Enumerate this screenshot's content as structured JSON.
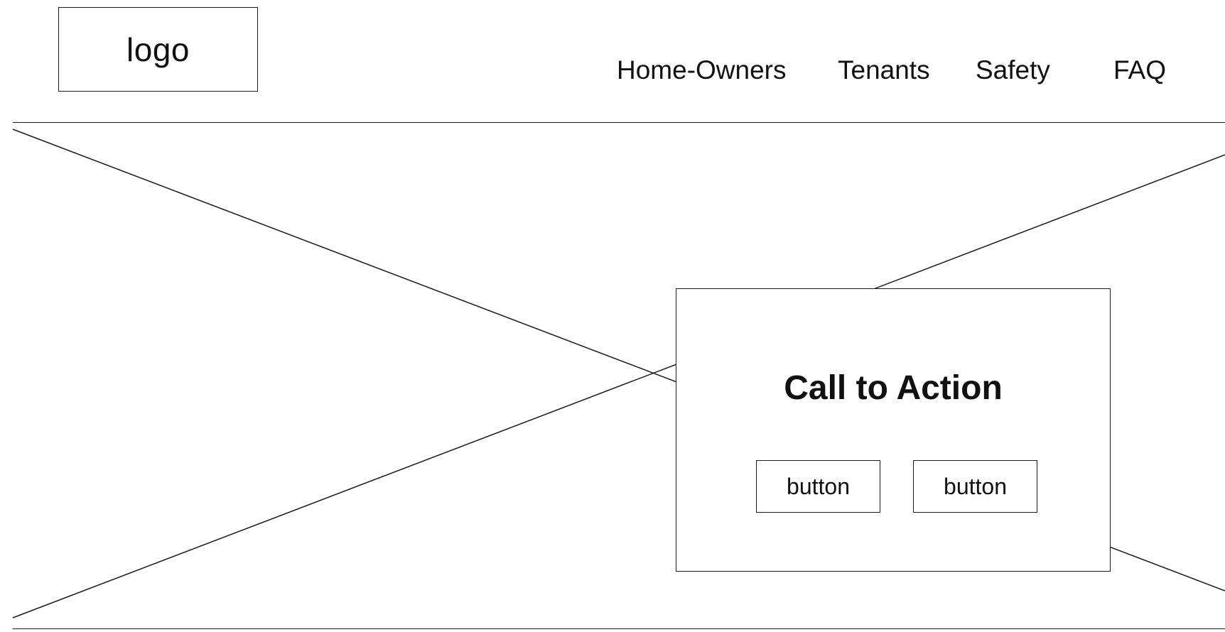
{
  "header": {
    "logo_text": "logo",
    "nav": {
      "home_owners": "Home-Owners",
      "tenants": "Tenants",
      "safety": "Safety",
      "faq": "FAQ"
    }
  },
  "hero": {
    "image_placeholder": "image-placeholder-icon",
    "cta": {
      "title": "Call to Action",
      "button_1": "button",
      "button_2": "button"
    }
  },
  "colors": {
    "background": "#ffffff",
    "stroke": "#1a1a1a",
    "text": "#111111"
  }
}
